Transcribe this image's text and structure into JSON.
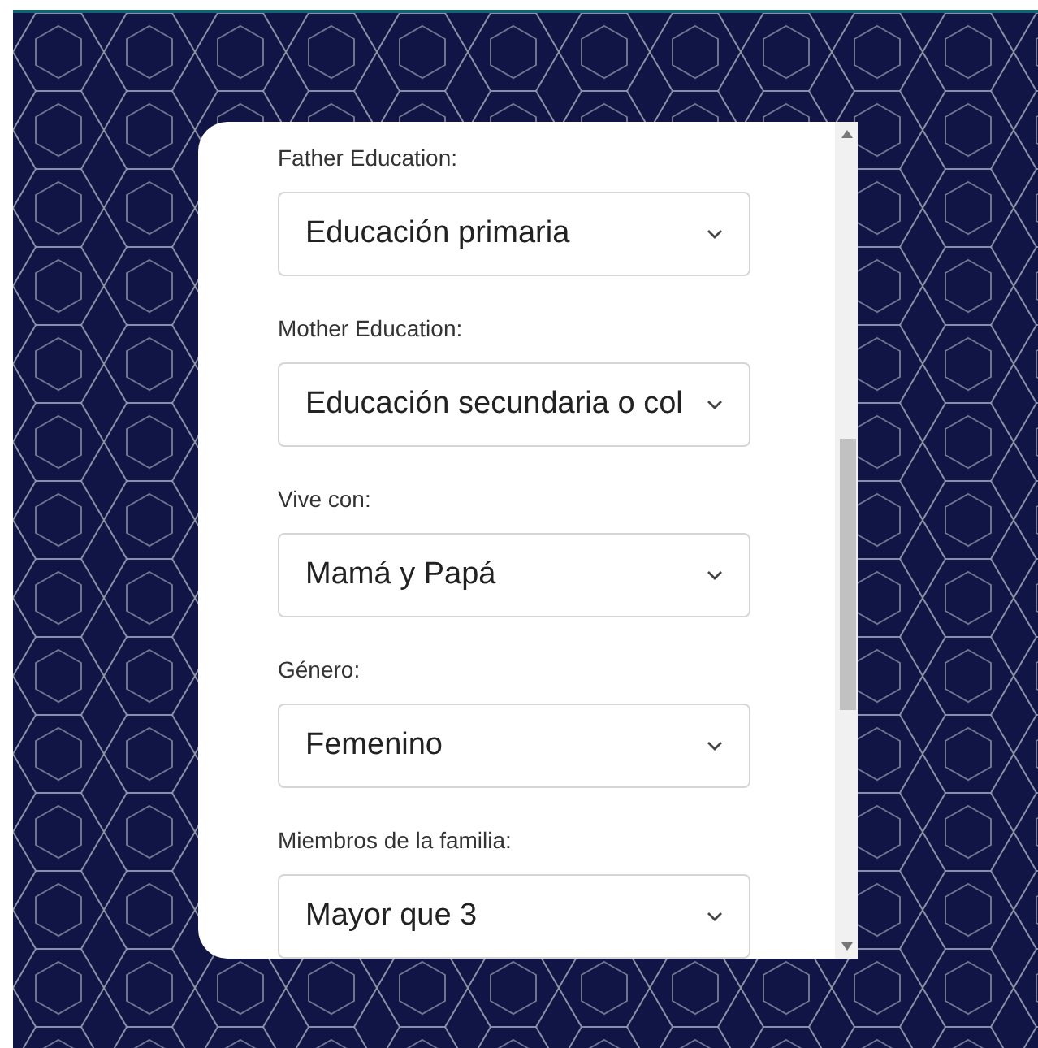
{
  "form": {
    "fields": [
      {
        "label": "Father Education:",
        "value": "Educación primaria"
      },
      {
        "label": "Mother Education:",
        "value": "Educación secundaria o col"
      },
      {
        "label": "Vive con:",
        "value": "Mamá y Papá"
      },
      {
        "label": "Género:",
        "value": "Femenino"
      },
      {
        "label": "Miembros de la familia:",
        "value": "Mayor que 3"
      }
    ]
  }
}
